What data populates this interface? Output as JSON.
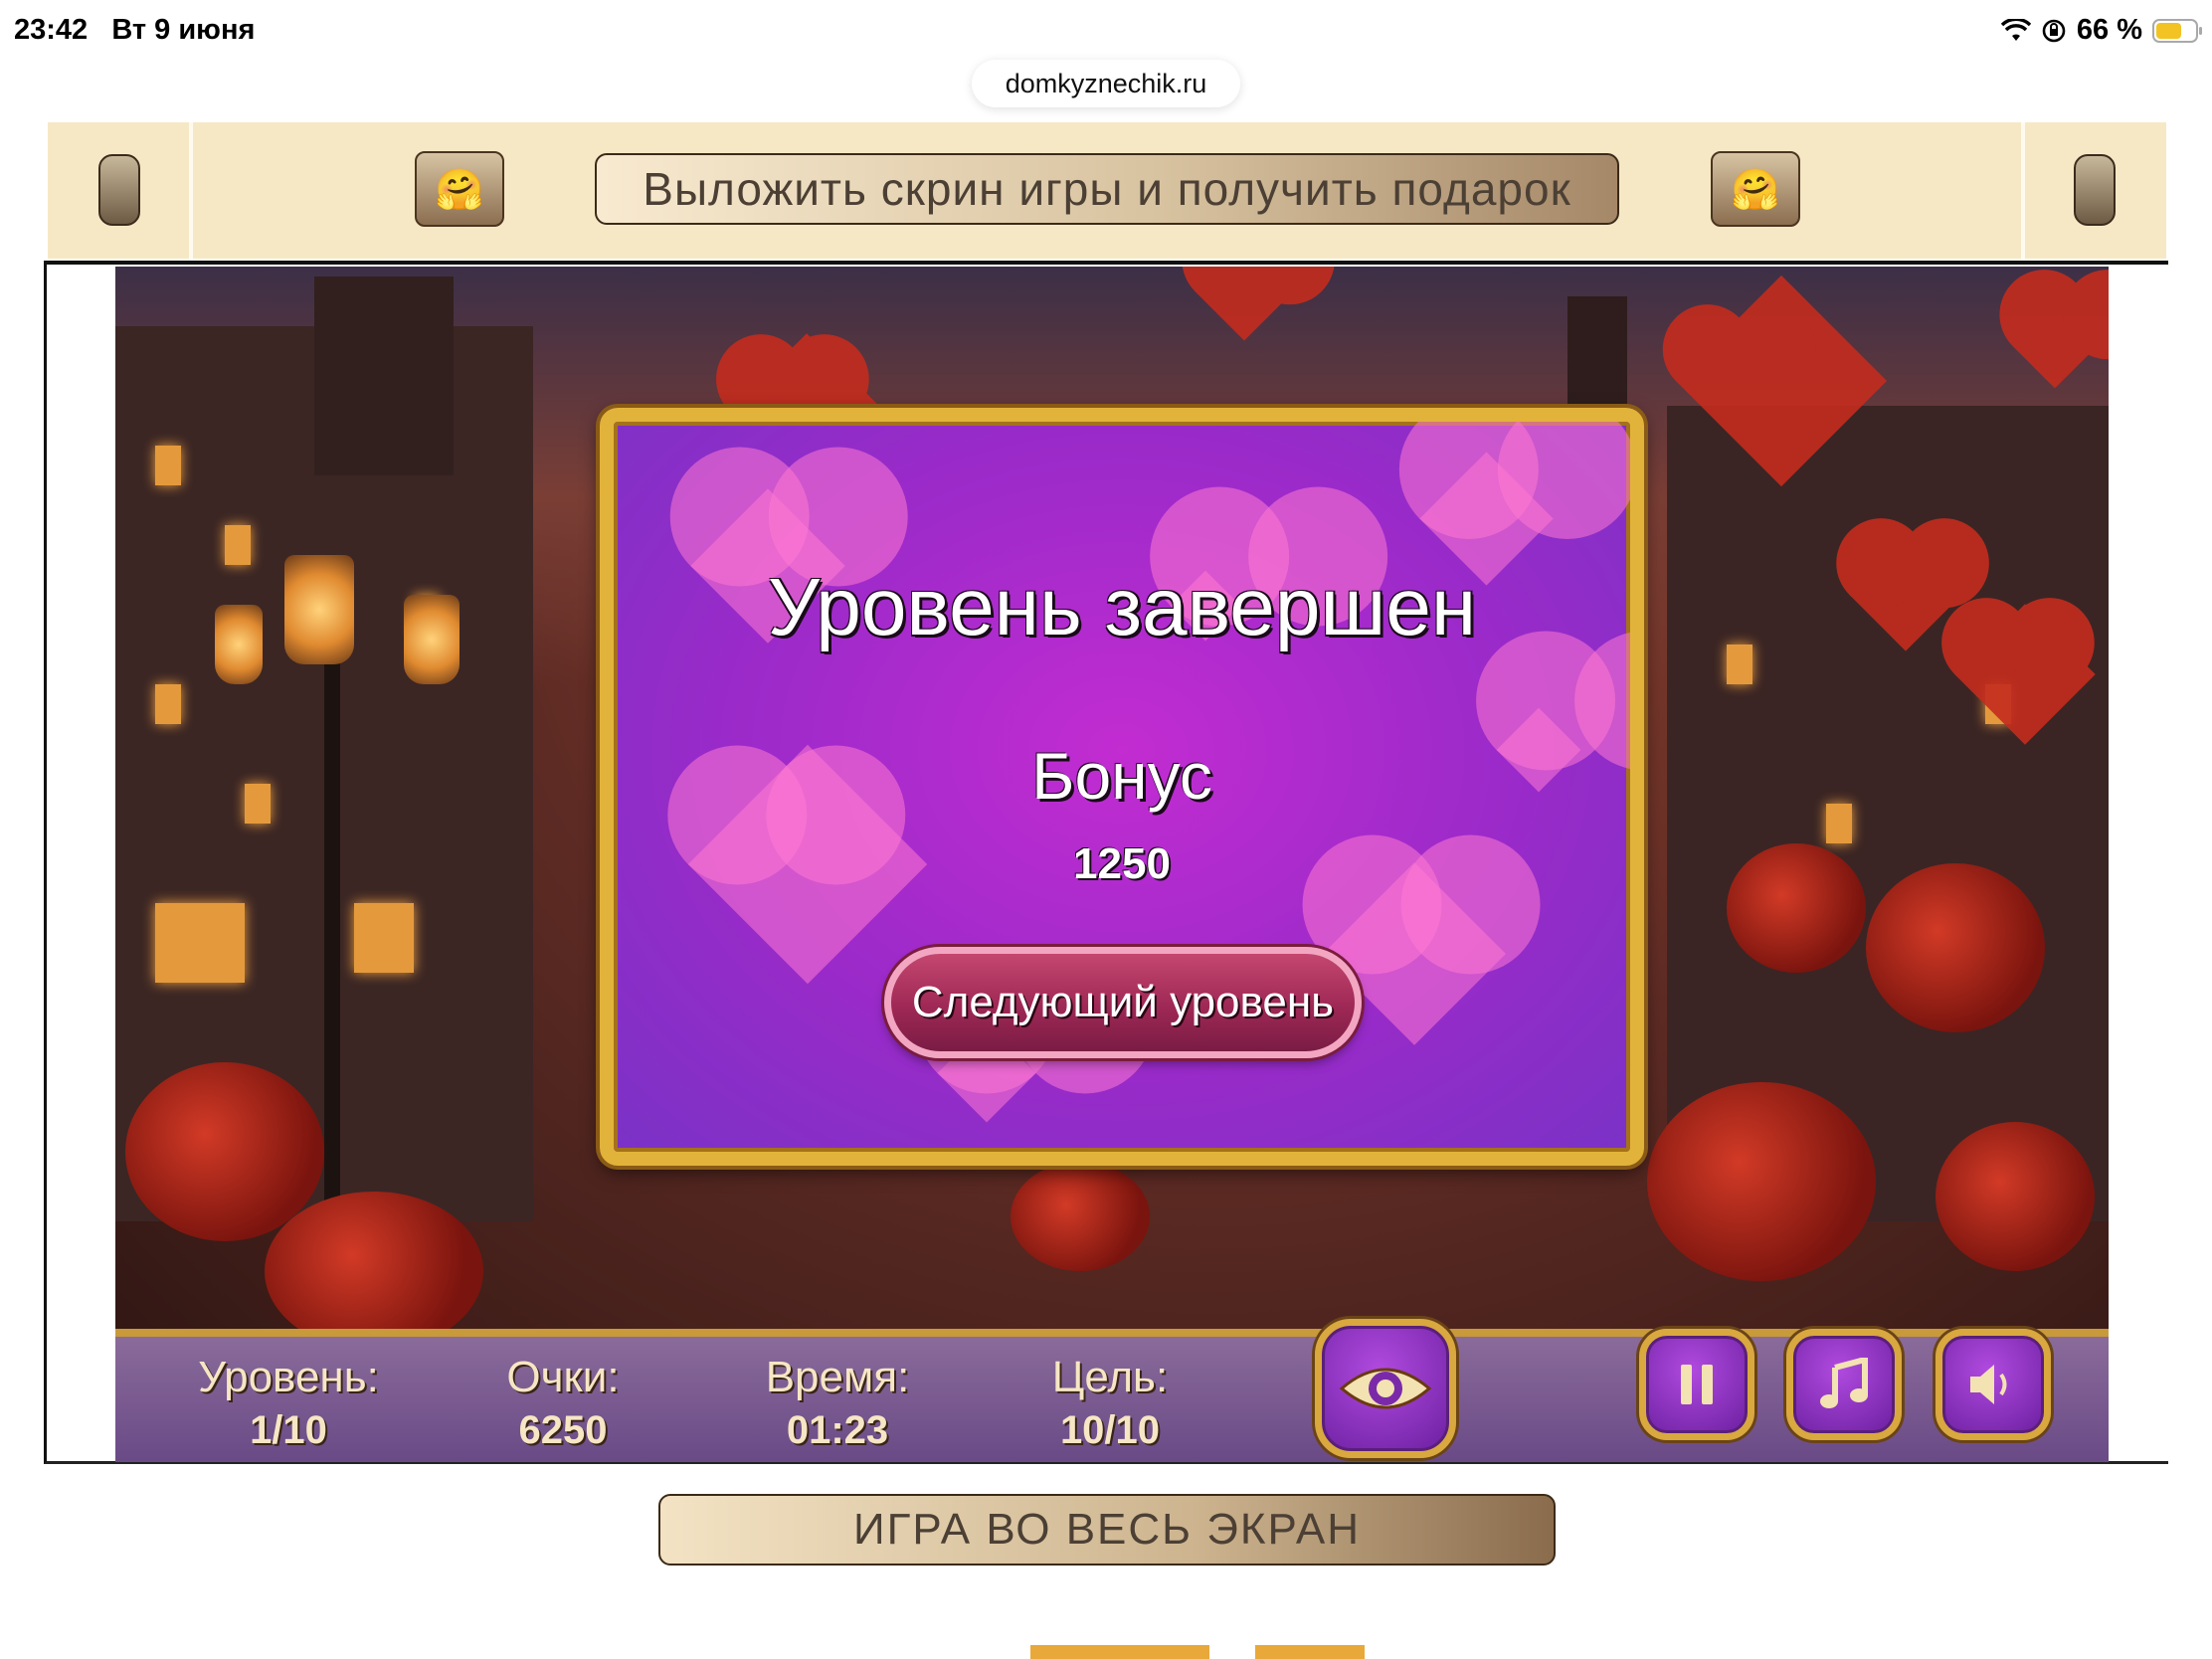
{
  "status_bar": {
    "time": "23:42",
    "date": "Вт 9 июня",
    "battery_percent_label": "66 %",
    "battery_level": 0.66
  },
  "browser": {
    "url": "domkyznechik.ru"
  },
  "banner": {
    "gift_button_label": "Выложить скрин игры и получить подарок",
    "emoji": "🤗"
  },
  "dialog": {
    "title": "Уровень завершен",
    "bonus_label": "Бонус",
    "bonus_value": "1250",
    "next_button_label": "Следующий уровень"
  },
  "hud": {
    "level_label": "Уровень:",
    "level_value": "1/10",
    "score_label": "Очки:",
    "score_value": "6250",
    "time_label": "Время:",
    "time_value": "01:23",
    "goal_label": "Цель:",
    "goal_value": "10/10",
    "buttons": [
      "eye-icon",
      "pause-icon",
      "music-icon",
      "sound-icon"
    ]
  },
  "fullscreen_button_label": "ИГРА ВО ВЕСЬ ЭКРАН",
  "colors": {
    "dialog_bg": "#9a2ac9",
    "dialog_border": "#e2b33a",
    "next_button": "#9e2855",
    "banner_bg": "#f7e8c5",
    "hud_bg": "#6a4a86"
  }
}
